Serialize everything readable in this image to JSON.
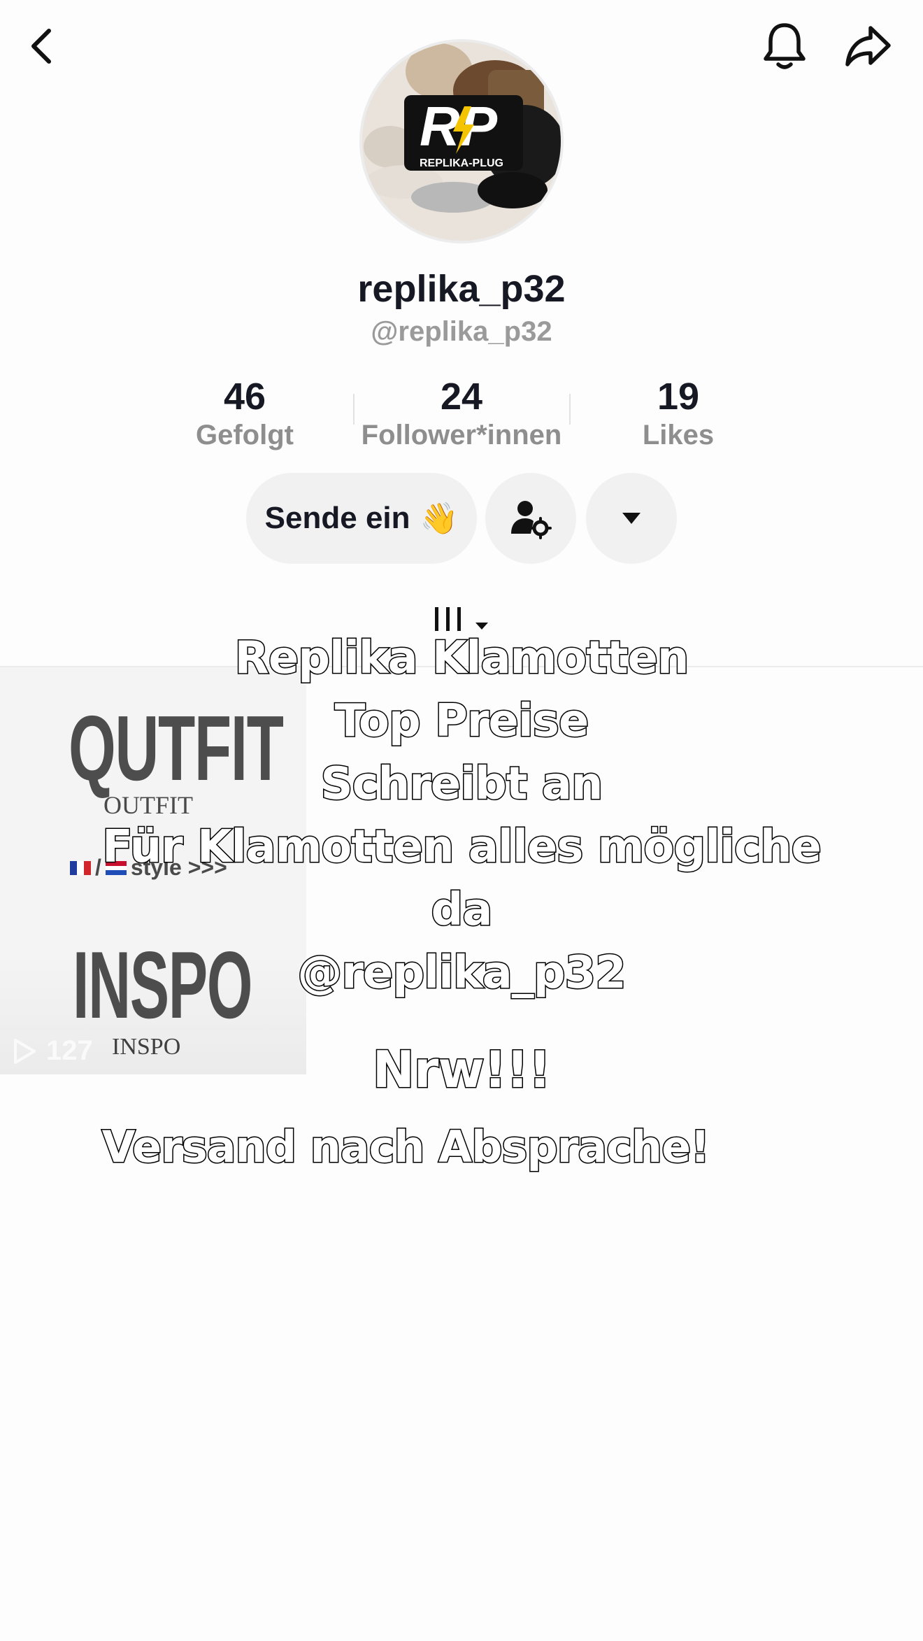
{
  "header": {
    "back_icon": "chevron-left-icon",
    "bell_icon": "bell-icon",
    "share_icon": "share-arrow-icon"
  },
  "profile": {
    "avatar_text": "RP",
    "avatar_subtext": "REPLIKA-PLUG",
    "username": "replika_p32",
    "handle": "@replika_p32"
  },
  "stats": [
    {
      "value": "46",
      "label": "Gefolgt"
    },
    {
      "value": "24",
      "label": "Follower*innen"
    },
    {
      "value": "19",
      "label": "Likes"
    }
  ],
  "actions": {
    "message_label": "Sende ein",
    "message_emoji": "👋",
    "follow_settings_icon": "person-gear-icon",
    "dropdown_icon": "caret-down-icon"
  },
  "tabs": {
    "videos_icon": "grid-bars-icon"
  },
  "video": {
    "title_big": "QUTFIT",
    "title_small": "OUTFIT",
    "style_text": "style >>>",
    "inspo_big": "INSPO",
    "inspo_small": "INSPO",
    "views": "127"
  },
  "overlay": {
    "lines": [
      "Replika Klamotten",
      "Top Preise",
      "Schreibt an",
      "Für Klamotten alles mögliche",
      "da",
      "@replika_p32"
    ],
    "nrw": "Nrw!!!",
    "versand": "Versand nach Absprache!"
  },
  "colors": {
    "background": "#fdfdfd",
    "button_bg": "#f1f1f2",
    "muted_text": "#8e8e8e"
  }
}
